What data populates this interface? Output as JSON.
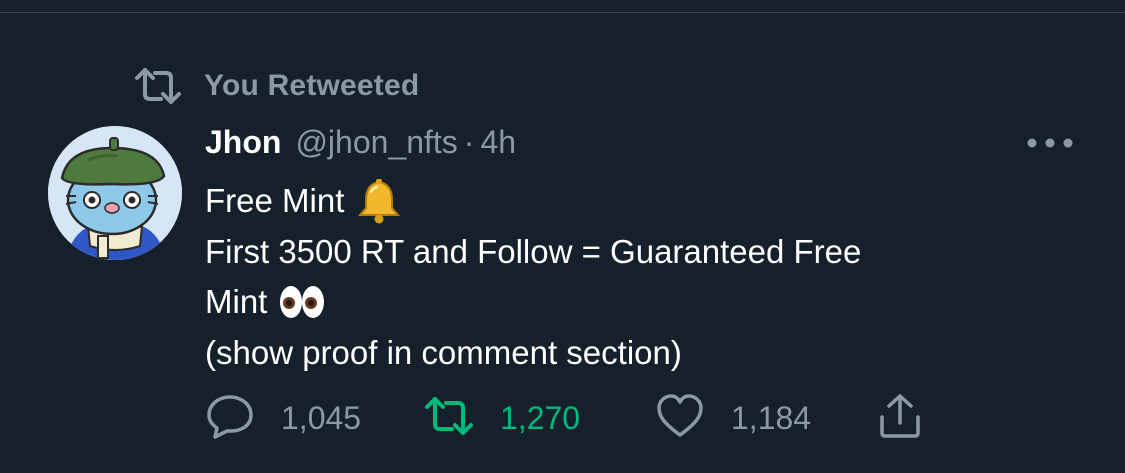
{
  "retweet_context": {
    "text": "You Retweeted"
  },
  "tweet": {
    "author_name": "Jhon",
    "handle": "@jhon_nfts",
    "separator": "·",
    "time": "4h",
    "lines": [
      "Free Mint",
      "First 3500 RT and Follow  = Guaranteed Free",
      "Mint",
      "(show proof in comment section)"
    ],
    "emojis": [
      "bell-emoji",
      "eyes-emoji"
    ]
  },
  "actions": {
    "reply_count": "1,045",
    "retweet_count": "1,270",
    "like_count": "1,184"
  },
  "colors": {
    "background": "#15202b",
    "text_primary": "#ffffff",
    "text_secondary": "#8b98a5",
    "retweet_active": "#00ba7c",
    "divider": "#38444d"
  },
  "icons": [
    "retweet-icon",
    "more-icon",
    "reply-icon",
    "retweet-icon",
    "like-icon",
    "share-icon"
  ]
}
